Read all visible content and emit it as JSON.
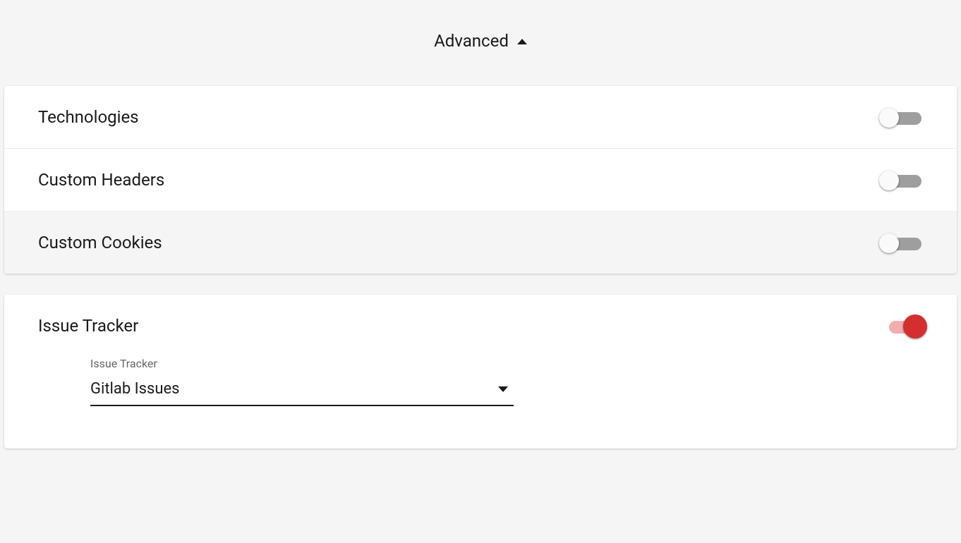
{
  "header": {
    "title": "Advanced"
  },
  "settings": {
    "rows": [
      {
        "label": "Technologies",
        "enabled": false,
        "highlighted": false
      },
      {
        "label": "Custom Headers",
        "enabled": false,
        "highlighted": false
      },
      {
        "label": "Custom Cookies",
        "enabled": false,
        "highlighted": true
      }
    ]
  },
  "issueTracker": {
    "label": "Issue Tracker",
    "enabled": true,
    "selectLabel": "Issue Tracker",
    "selectValue": "Gitlab Issues"
  }
}
